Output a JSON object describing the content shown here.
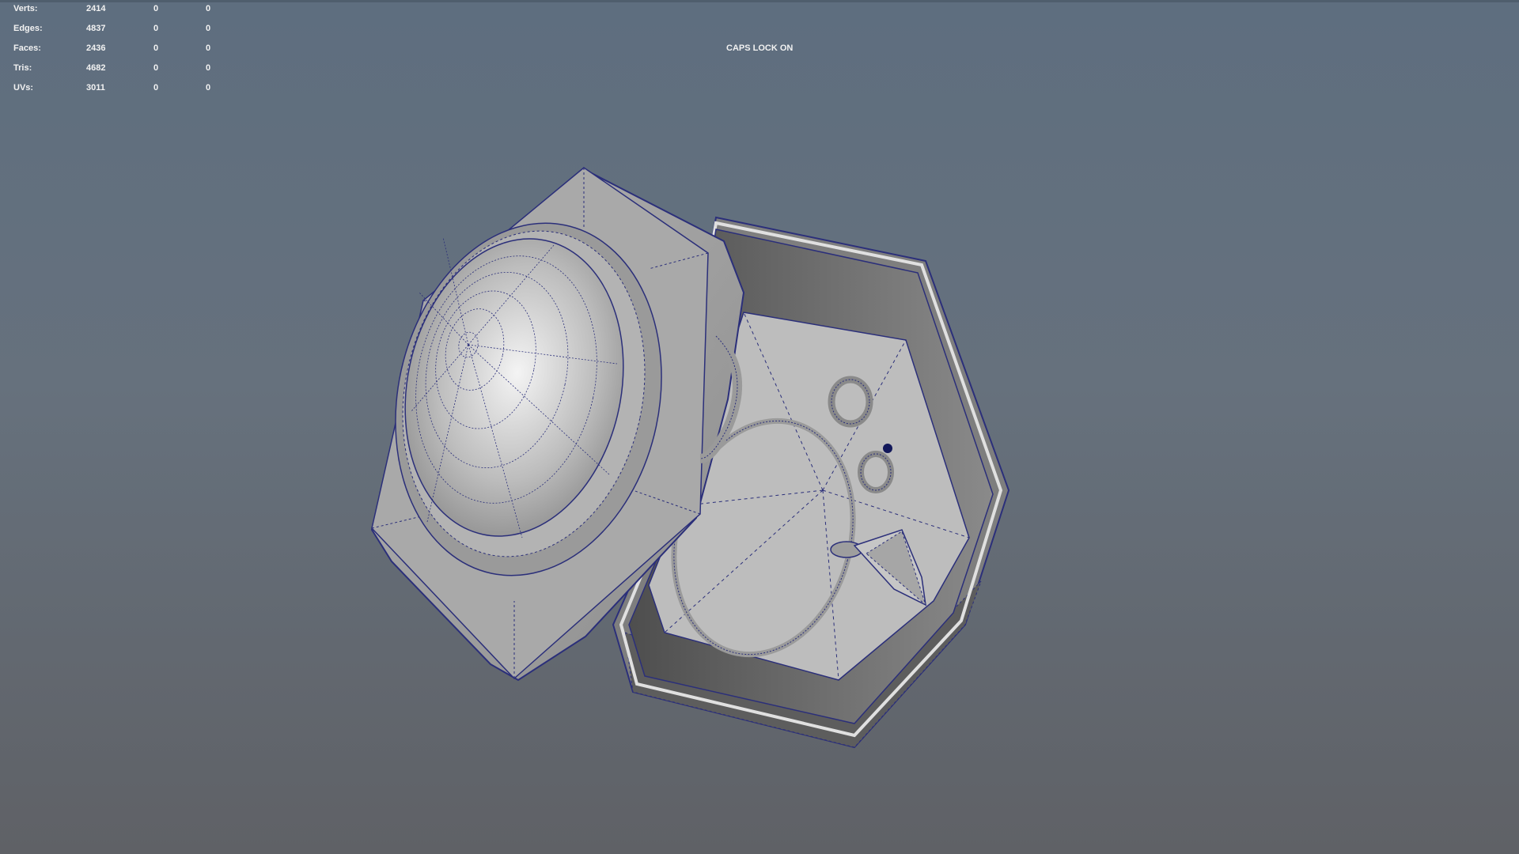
{
  "hud": {
    "rows": [
      {
        "label": "Verts:",
        "c1": "2414",
        "c2": "0",
        "c3": "0"
      },
      {
        "label": "Edges:",
        "c1": "4837",
        "c2": "0",
        "c3": "0"
      },
      {
        "label": "Faces:",
        "c1": "2436",
        "c2": "0",
        "c3": "0"
      },
      {
        "label": "Tris:",
        "c1": "4682",
        "c2": "0",
        "c3": "0"
      },
      {
        "label": "UVs:",
        "c1": "3011",
        "c2": "0",
        "c3": "0"
      }
    ]
  },
  "caps_lock": "CAPS LOCK ON",
  "colors": {
    "wire": "#2b2f7a",
    "mesh_light": "#c9c9c9",
    "mesh_mid": "#a8a8a8",
    "mesh_dark": "#5a5a5a"
  }
}
